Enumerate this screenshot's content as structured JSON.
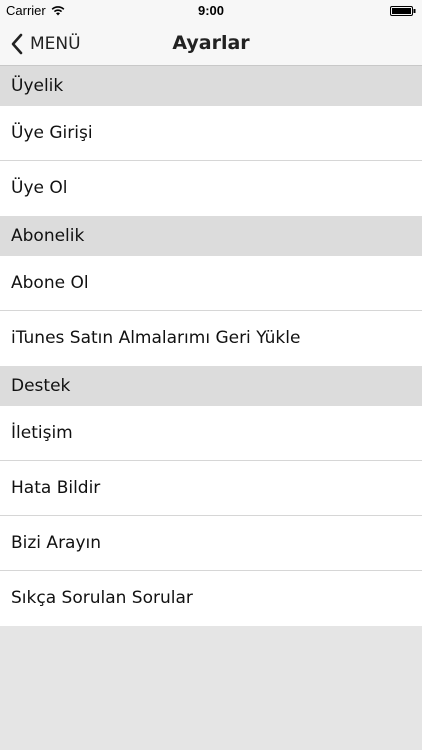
{
  "status_bar": {
    "carrier": "Carrier",
    "time": "9:00",
    "wifi_icon": "wifi-icon",
    "battery_icon": "battery-icon"
  },
  "nav": {
    "back_label": "MENÜ",
    "back_icon": "chevron-left-icon",
    "title": "Ayarlar"
  },
  "sections": [
    {
      "header": "Üyelik",
      "rows": [
        "Üye Girişi",
        "Üye Ol"
      ]
    },
    {
      "header": "Abonelik",
      "rows": [
        "Abone Ol",
        "iTunes Satın Almalarımı Geri Yükle"
      ]
    },
    {
      "header": "Destek",
      "rows": [
        "İletişim",
        "Hata Bildir",
        "Bizi Arayın",
        "Sıkça Sorulan Sorular"
      ]
    }
  ],
  "colors": {
    "background": "#e5e5e5",
    "section_header": "#dcdcdc",
    "row": "#ffffff",
    "bar": "#f7f7f7"
  }
}
